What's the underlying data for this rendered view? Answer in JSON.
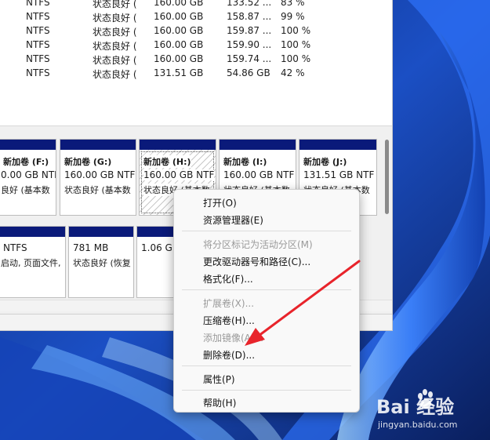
{
  "volumes": [
    {
      "fs": "NTFS",
      "status": "状态良好 (",
      "capacity": "160.00 GB",
      "free": "133.52 ...",
      "pct": "83 %"
    },
    {
      "fs": "NTFS",
      "status": "状态良好 (",
      "capacity": "160.00 GB",
      "free": "158.87 ...",
      "pct": "99 %"
    },
    {
      "fs": "NTFS",
      "status": "状态良好 (",
      "capacity": "160.00 GB",
      "free": "159.87 ...",
      "pct": "100 %"
    },
    {
      "fs": "NTFS",
      "status": "状态良好 (",
      "capacity": "160.00 GB",
      "free": "159.90 ...",
      "pct": "100 %"
    },
    {
      "fs": "NTFS",
      "status": "状态良好 (",
      "capacity": "160.00 GB",
      "free": "159.74 ...",
      "pct": "100 %"
    },
    {
      "fs": "NTFS",
      "status": "状态良好 (",
      "capacity": "131.51 GB",
      "free": "54.86 GB",
      "pct": "42 %"
    }
  ],
  "top_partitions": [
    {
      "name": "新加卷  (F:)",
      "size": "0.00 GB NTF",
      "status": "良好 (基本数"
    },
    {
      "name": "新加卷  (G:)",
      "size": "160.00 GB NTF",
      "status": "状态良好 (基本数"
    },
    {
      "name": "新加卷  (H:)",
      "size": "160.00 GB NTF",
      "status": "状态良好 (基本数"
    },
    {
      "name": "新加卷  (I:)",
      "size": "160.00 GB NTF",
      "status": "状态良好 (基本数"
    },
    {
      "name": "新加卷  (J:)",
      "size": "131.51 GB NTF",
      "status": "状态良好 (基本数"
    }
  ],
  "bottom_partitions": [
    {
      "line1": "NTFS",
      "line2": "启动, 页面文件,"
    },
    {
      "line1": "781 MB",
      "line2": "状态良好 (恢复"
    },
    {
      "line1": "1.06 GB",
      "line2": ""
    }
  ],
  "context_menu": {
    "open": "打开(O)",
    "explorer": "资源管理器(E)",
    "mark_active": "将分区标记为活动分区(M)",
    "change_letter": "更改驱动器号和路径(C)...",
    "format": "格式化(F)...",
    "extend": "扩展卷(X)...",
    "shrink": "压缩卷(H)...",
    "add_mirror": "添加镜像(A)...",
    "delete": "删除卷(D)...",
    "properties": "属性(P)",
    "help": "帮助(H)"
  },
  "watermark": {
    "brand": "Bai   经验",
    "url": "jingyan.baidu.com"
  },
  "colors": {
    "partition_bar": "#0a1a7a",
    "annotation_arrow": "#e8242b",
    "wallpaper_blue": "#1e5fd6"
  }
}
